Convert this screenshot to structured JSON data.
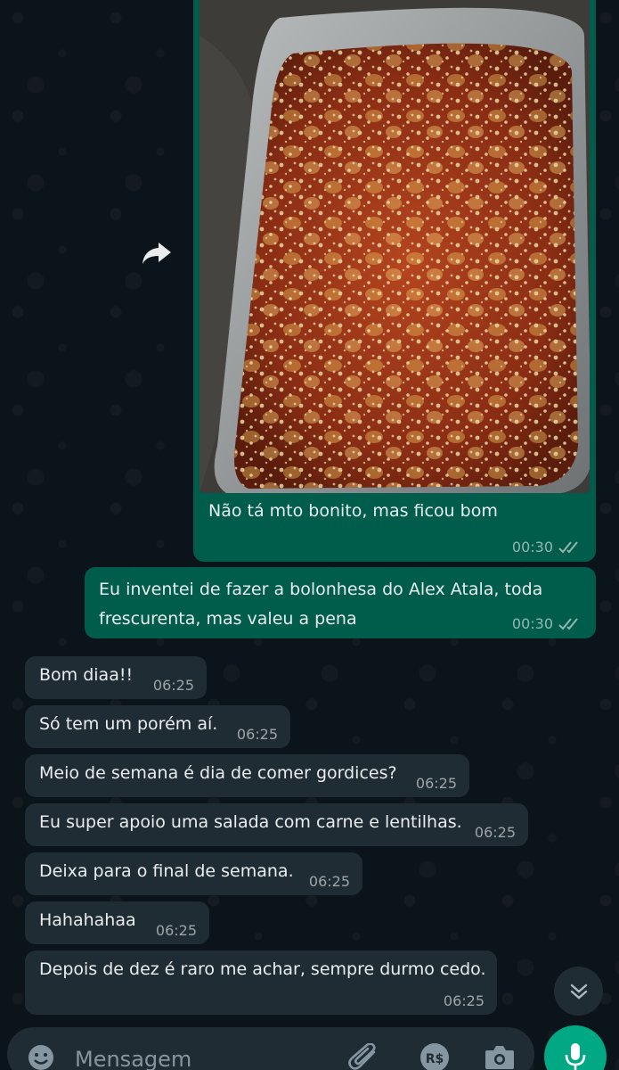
{
  "colors": {
    "background": "#0b141a",
    "outgoing_bubble": "#005c4b",
    "incoming_bubble": "#202c33",
    "accent": "#00a884",
    "meta_text": "#8696a0"
  },
  "messages": {
    "image_message": {
      "caption": "Não tá mto bonito, mas ficou bom",
      "time": "00:30",
      "status_icon": "double-check-icon"
    },
    "outgoing_text": {
      "text": "Eu inventei de fazer a bolonhesa do Alex Atala, toda frescurenta, mas valeu a pena",
      "time": "00:30",
      "status_icon": "double-check-icon"
    },
    "incoming": [
      {
        "text": "Bom diaa!!",
        "time": "06:25"
      },
      {
        "text": "Só tem um porém aí.",
        "time": "06:25"
      },
      {
        "text": "Meio de semana é dia de comer gordices?",
        "time": "06:25"
      },
      {
        "text": "Eu super apoio uma salada com carne e lentilhas.",
        "time": "06:25"
      },
      {
        "text": "Deixa para o final de semana.",
        "time": "06:25"
      },
      {
        "text": "Hahahahaa",
        "time": "06:25"
      },
      {
        "text": "Depois de dez é raro me achar, sempre durmo cedo.",
        "time": "06:25"
      }
    ]
  },
  "composer": {
    "placeholder": "Mensagem",
    "icons": [
      "emoji-icon",
      "attach-icon",
      "payment-icon",
      "camera-icon",
      "microphone-icon"
    ]
  }
}
